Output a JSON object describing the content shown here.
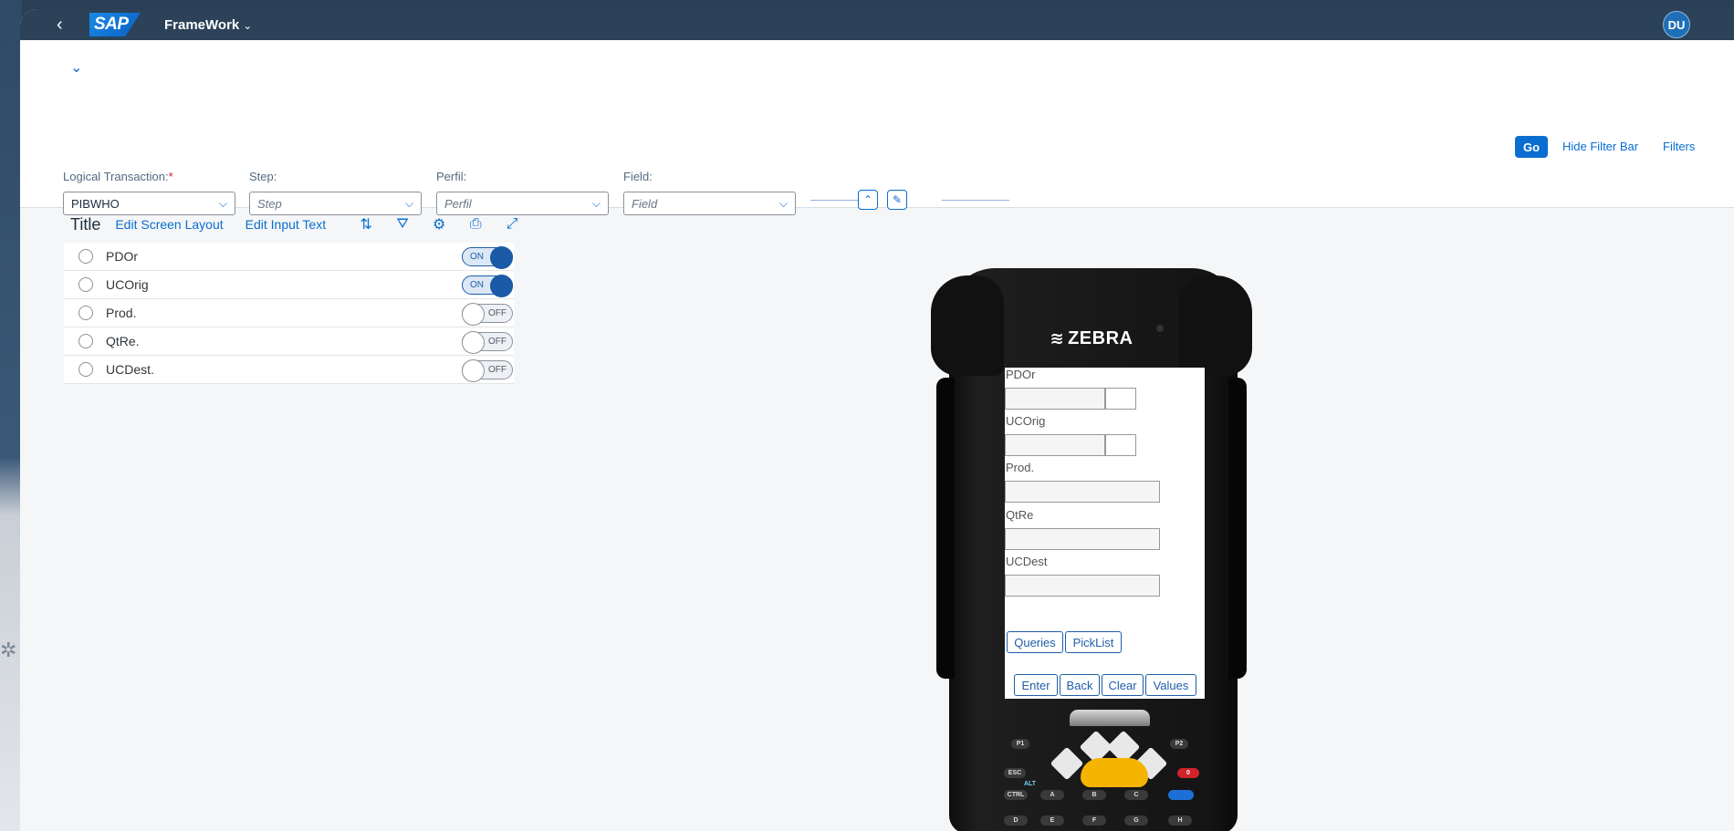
{
  "shell": {
    "logo": "SAP",
    "app_title": "FrameWork",
    "avatar_initials": "DU"
  },
  "filter_bar": {
    "go": "Go",
    "hide_filter_bar": "Hide Filter Bar",
    "filters": "Filters",
    "fields": [
      {
        "label": "Logical Transaction:",
        "required_mark": "*",
        "value": "PIBWHO",
        "placeholder": ""
      },
      {
        "label": "Step:",
        "required_mark": "",
        "value": "",
        "placeholder": "Step"
      },
      {
        "label": "Perfil:",
        "required_mark": "",
        "value": "",
        "placeholder": "Perfil"
      },
      {
        "label": "Field:",
        "required_mark": "",
        "value": "",
        "placeholder": "Field"
      }
    ]
  },
  "table_toolbar": {
    "title": "Title",
    "edit_screen_layout": "Edit Screen Layout",
    "edit_input_text": "Edit Input Text",
    "icons": [
      "sort-icon",
      "filter-icon",
      "settings-icon",
      "print-icon",
      "fullscreen-icon"
    ]
  },
  "rows": [
    {
      "label": "PDOr",
      "switch": "ON"
    },
    {
      "label": "UCOrig",
      "switch": "ON"
    },
    {
      "label": "Prod.",
      "switch": "OFF"
    },
    {
      "label": "QtRe.",
      "switch": "OFF"
    },
    {
      "label": "UCDest.",
      "switch": "OFF"
    }
  ],
  "device": {
    "brand": "ZEBRA",
    "screen": {
      "fields": [
        "PDOr",
        "UCOrig",
        "Prod.",
        "QtRe",
        "UCDest"
      ],
      "buttons_row1": [
        "Queries",
        "PickList"
      ],
      "buttons_row2": [
        "Enter",
        "Back",
        "Clear",
        "Values"
      ]
    },
    "keys": {
      "p1": "P1",
      "p2": "P2",
      "esc": "ESC",
      "zero": "0",
      "alt": "ALT",
      "ctrl": "CTRL",
      "a": "A",
      "b": "B",
      "c": "C",
      "d": "D",
      "e": "E",
      "f": "F",
      "g": "G",
      "h": "H"
    }
  },
  "colors": {
    "shell": "#2b4258",
    "accent": "#0a6ed1",
    "switch_on": "#1a5aa6"
  }
}
